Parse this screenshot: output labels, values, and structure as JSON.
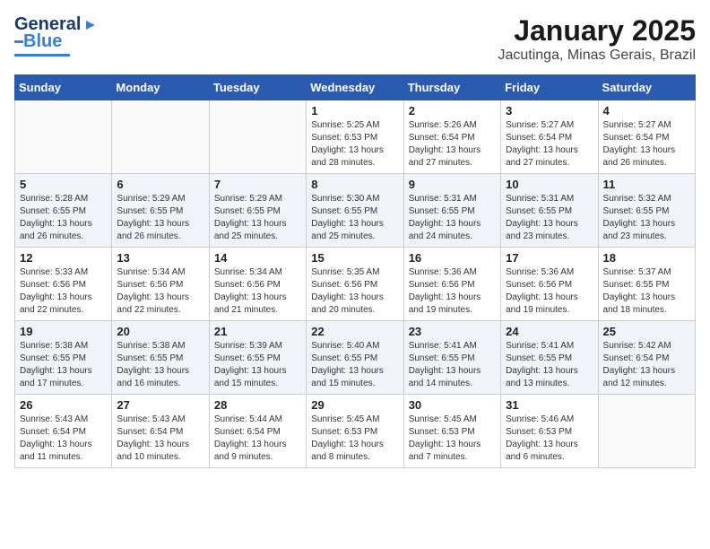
{
  "header": {
    "logo_general": "General",
    "logo_blue": "Blue",
    "month_title": "January 2025",
    "location": "Jacutinga, Minas Gerais, Brazil"
  },
  "days_of_week": [
    "Sunday",
    "Monday",
    "Tuesday",
    "Wednesday",
    "Thursday",
    "Friday",
    "Saturday"
  ],
  "weeks": [
    [
      {
        "num": "",
        "info": ""
      },
      {
        "num": "",
        "info": ""
      },
      {
        "num": "",
        "info": ""
      },
      {
        "num": "1",
        "info": "Sunrise: 5:25 AM\nSunset: 6:53 PM\nDaylight: 13 hours\nand 28 minutes."
      },
      {
        "num": "2",
        "info": "Sunrise: 5:26 AM\nSunset: 6:54 PM\nDaylight: 13 hours\nand 27 minutes."
      },
      {
        "num": "3",
        "info": "Sunrise: 5:27 AM\nSunset: 6:54 PM\nDaylight: 13 hours\nand 27 minutes."
      },
      {
        "num": "4",
        "info": "Sunrise: 5:27 AM\nSunset: 6:54 PM\nDaylight: 13 hours\nand 26 minutes."
      }
    ],
    [
      {
        "num": "5",
        "info": "Sunrise: 5:28 AM\nSunset: 6:55 PM\nDaylight: 13 hours\nand 26 minutes."
      },
      {
        "num": "6",
        "info": "Sunrise: 5:29 AM\nSunset: 6:55 PM\nDaylight: 13 hours\nand 26 minutes."
      },
      {
        "num": "7",
        "info": "Sunrise: 5:29 AM\nSunset: 6:55 PM\nDaylight: 13 hours\nand 25 minutes."
      },
      {
        "num": "8",
        "info": "Sunrise: 5:30 AM\nSunset: 6:55 PM\nDaylight: 13 hours\nand 25 minutes."
      },
      {
        "num": "9",
        "info": "Sunrise: 5:31 AM\nSunset: 6:55 PM\nDaylight: 13 hours\nand 24 minutes."
      },
      {
        "num": "10",
        "info": "Sunrise: 5:31 AM\nSunset: 6:55 PM\nDaylight: 13 hours\nand 23 minutes."
      },
      {
        "num": "11",
        "info": "Sunrise: 5:32 AM\nSunset: 6:55 PM\nDaylight: 13 hours\nand 23 minutes."
      }
    ],
    [
      {
        "num": "12",
        "info": "Sunrise: 5:33 AM\nSunset: 6:56 PM\nDaylight: 13 hours\nand 22 minutes."
      },
      {
        "num": "13",
        "info": "Sunrise: 5:34 AM\nSunset: 6:56 PM\nDaylight: 13 hours\nand 22 minutes."
      },
      {
        "num": "14",
        "info": "Sunrise: 5:34 AM\nSunset: 6:56 PM\nDaylight: 13 hours\nand 21 minutes."
      },
      {
        "num": "15",
        "info": "Sunrise: 5:35 AM\nSunset: 6:56 PM\nDaylight: 13 hours\nand 20 minutes."
      },
      {
        "num": "16",
        "info": "Sunrise: 5:36 AM\nSunset: 6:56 PM\nDaylight: 13 hours\nand 19 minutes."
      },
      {
        "num": "17",
        "info": "Sunrise: 5:36 AM\nSunset: 6:56 PM\nDaylight: 13 hours\nand 19 minutes."
      },
      {
        "num": "18",
        "info": "Sunrise: 5:37 AM\nSunset: 6:55 PM\nDaylight: 13 hours\nand 18 minutes."
      }
    ],
    [
      {
        "num": "19",
        "info": "Sunrise: 5:38 AM\nSunset: 6:55 PM\nDaylight: 13 hours\nand 17 minutes."
      },
      {
        "num": "20",
        "info": "Sunrise: 5:38 AM\nSunset: 6:55 PM\nDaylight: 13 hours\nand 16 minutes."
      },
      {
        "num": "21",
        "info": "Sunrise: 5:39 AM\nSunset: 6:55 PM\nDaylight: 13 hours\nand 15 minutes."
      },
      {
        "num": "22",
        "info": "Sunrise: 5:40 AM\nSunset: 6:55 PM\nDaylight: 13 hours\nand 15 minutes."
      },
      {
        "num": "23",
        "info": "Sunrise: 5:41 AM\nSunset: 6:55 PM\nDaylight: 13 hours\nand 14 minutes."
      },
      {
        "num": "24",
        "info": "Sunrise: 5:41 AM\nSunset: 6:55 PM\nDaylight: 13 hours\nand 13 minutes."
      },
      {
        "num": "25",
        "info": "Sunrise: 5:42 AM\nSunset: 6:54 PM\nDaylight: 13 hours\nand 12 minutes."
      }
    ],
    [
      {
        "num": "26",
        "info": "Sunrise: 5:43 AM\nSunset: 6:54 PM\nDaylight: 13 hours\nand 11 minutes."
      },
      {
        "num": "27",
        "info": "Sunrise: 5:43 AM\nSunset: 6:54 PM\nDaylight: 13 hours\nand 10 minutes."
      },
      {
        "num": "28",
        "info": "Sunrise: 5:44 AM\nSunset: 6:54 PM\nDaylight: 13 hours\nand 9 minutes."
      },
      {
        "num": "29",
        "info": "Sunrise: 5:45 AM\nSunset: 6:53 PM\nDaylight: 13 hours\nand 8 minutes."
      },
      {
        "num": "30",
        "info": "Sunrise: 5:45 AM\nSunset: 6:53 PM\nDaylight: 13 hours\nand 7 minutes."
      },
      {
        "num": "31",
        "info": "Sunrise: 5:46 AM\nSunset: 6:53 PM\nDaylight: 13 hours\nand 6 minutes."
      },
      {
        "num": "",
        "info": ""
      }
    ]
  ]
}
